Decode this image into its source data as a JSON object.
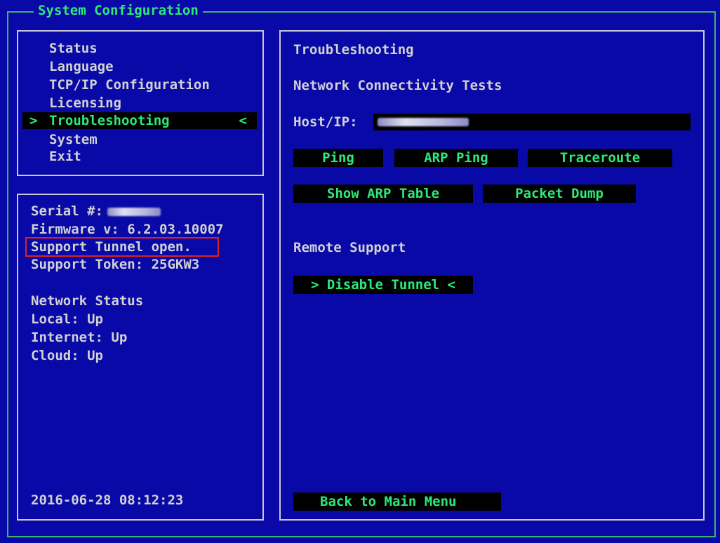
{
  "window": {
    "title": "System Configuration"
  },
  "menu": {
    "items": [
      {
        "label": "Status"
      },
      {
        "label": "Language"
      },
      {
        "label": "TCP/IP Configuration"
      },
      {
        "label": "Licensing"
      },
      {
        "label": "Troubleshooting",
        "selected": true
      },
      {
        "label": "System"
      },
      {
        "label": "Exit"
      }
    ],
    "selected_label": "Troubleshooting",
    "arrow_left": ">",
    "arrow_right": "<"
  },
  "info": {
    "serial_label": "Serial #:",
    "firmware": "Firmware v: 6.2.03.10007",
    "tunnel_status": "Support Tunnel open.",
    "support_token": "Support Token: 25GKW3",
    "network_heading": "Network Status",
    "local": "Local: Up",
    "internet": "Internet: Up",
    "cloud": "Cloud: Up",
    "datetime": "2016-06-28 08:12:23"
  },
  "main": {
    "title": "Troubleshooting",
    "tests_heading": "Network Connectivity Tests",
    "host_label": "Host/IP:",
    "buttons": {
      "ping": "Ping",
      "arp_ping": "ARP Ping",
      "traceroute": "Traceroute",
      "show_arp_table": "Show ARP Table",
      "packet_dump": "Packet Dump"
    },
    "remote_heading": "Remote Support",
    "disable_tunnel": "> Disable Tunnel <",
    "back": "Back to Main Menu"
  },
  "colors": {
    "background": "#0909a8",
    "text": "#d2d2d2",
    "accent": "#2ee87a",
    "highlight_box": "#e02020"
  }
}
